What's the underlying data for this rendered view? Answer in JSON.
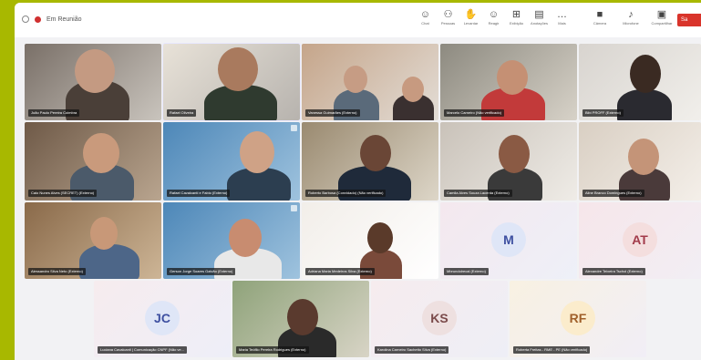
{
  "window": {
    "title": "Em Reunião"
  },
  "toolbar": {
    "tools": [
      {
        "label": "Chat",
        "icon": "chat-icon"
      },
      {
        "label": "Pessoas",
        "icon": "people-icon"
      },
      {
        "label": "Levantar",
        "icon": "raise-hand-icon"
      },
      {
        "label": "Reagir",
        "icon": "react-icon"
      },
      {
        "label": "Exibição",
        "icon": "view-icon"
      },
      {
        "label": "Anotações",
        "icon": "notes-icon"
      },
      {
        "label": "Mais",
        "icon": "more-icon"
      },
      {
        "label": "Câmera",
        "icon": "camera-icon"
      },
      {
        "label": "Microfone",
        "icon": "microphone-icon"
      },
      {
        "label": "Compartilhar",
        "icon": "share-icon"
      }
    ],
    "leave_label": "Sa"
  },
  "participants": [
    {
      "name": "João Paulo Pereira Coimbra",
      "avatar": ""
    },
    {
      "name": "Rafael Oliveira",
      "avatar": ""
    },
    {
      "name": "Vanessa Guimarães (Externo)",
      "avatar": ""
    },
    {
      "name": "Marcelo Carneiro (Não verificado)",
      "avatar": ""
    },
    {
      "name": "Bibi PROFF (Externo)",
      "avatar": ""
    },
    {
      "name": "Caio Nunes Alves (SECRET) (Externo)",
      "avatar": ""
    },
    {
      "name": "Rafael Cavalcanti e Fabio (Externo)",
      "avatar": ""
    },
    {
      "name": "Roberto Barbosa (Convidado) (Não verificado)",
      "avatar": ""
    },
    {
      "name": "Camila Alves Souza Lacerda (Externo)",
      "avatar": ""
    },
    {
      "name": "Aline Branco Domingues (Externo)",
      "avatar": ""
    },
    {
      "name": "Alessandro Silva Neto (Externo)",
      "avatar": ""
    },
    {
      "name": "Gerson Jorge Soares Galvão (Externo)",
      "avatar": ""
    },
    {
      "name": "Adriana Maria Medeiros Silva (Externo)",
      "avatar": ""
    },
    {
      "name": "Mbrundolrecal (Externo)",
      "avatar": "M"
    },
    {
      "name": "Alexandre Teixeira Tschol (Externo)",
      "avatar": "AT"
    },
    {
      "name": "Luciana Cavalcanti | Comunicação CNPF (Não ve...",
      "avatar": "JC"
    },
    {
      "name": "Maria Teófilo Pereira Rodrigues (Externo)",
      "avatar": ""
    },
    {
      "name": "Karolina Carneiro Sachetto Silva (Externo)",
      "avatar": "KS"
    },
    {
      "name": "Roberta Freitas - RME - PE (Não verificado)",
      "avatar": "RF"
    }
  ],
  "colors": {
    "avatar_bg": "#dfe6f7",
    "avatar_text": "#3d4fa0",
    "leave": "#d9342b"
  }
}
